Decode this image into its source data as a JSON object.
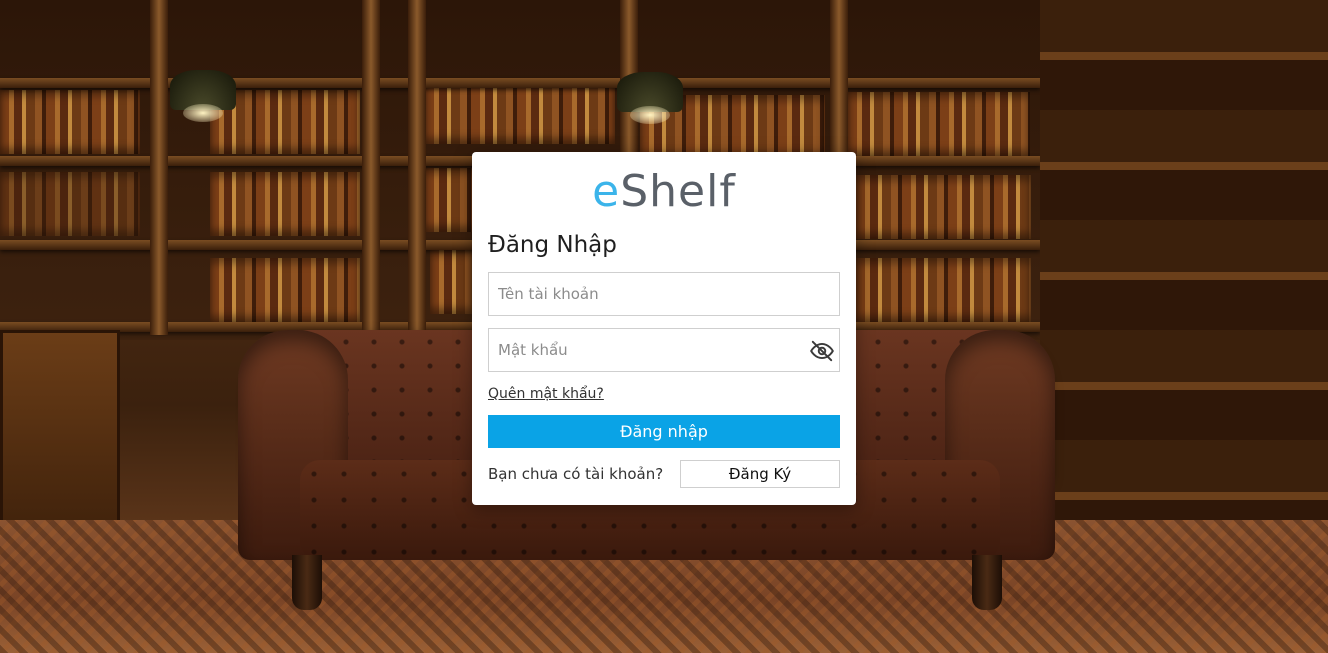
{
  "brand": {
    "logo_prefix": "e",
    "logo_suffix": "Shelf",
    "accent_color": "#3bb4ea"
  },
  "login": {
    "title": "Đăng Nhập",
    "username_placeholder": "Tên tài khoản",
    "username_value": "",
    "password_placeholder": "Mật khẩu",
    "password_value": "",
    "password_toggle_icon": "eye-slash-icon",
    "forgot_label": "Quên mật khẩu?",
    "submit_label": "Đăng nhập",
    "submit_color": "#0aa3e6",
    "no_account_text": "Bạn chưa có tài khoản?",
    "register_label": "Đăng Ký"
  },
  "background": {
    "scene": "library-with-leather-sofa"
  }
}
